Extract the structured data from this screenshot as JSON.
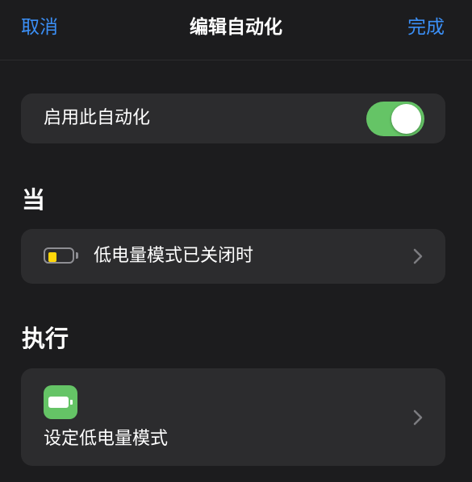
{
  "navbar": {
    "cancel_label": "取消",
    "title": "编辑自动化",
    "done_label": "完成"
  },
  "enable_toggle": {
    "label": "启用此自动化",
    "state": "on"
  },
  "when_section": {
    "header": "当",
    "trigger": {
      "icon": "battery-low-icon",
      "label": "低电量模式已关闭时"
    }
  },
  "do_section": {
    "header": "执行",
    "action": {
      "icon": "battery-icon",
      "label": "设定低电量模式"
    }
  },
  "colors": {
    "accent": "#3b8ff6",
    "toggle_on": "#65c466",
    "background": "#1c1c1e",
    "card": "#2c2c2e",
    "battery_low": "#ffd60a"
  }
}
